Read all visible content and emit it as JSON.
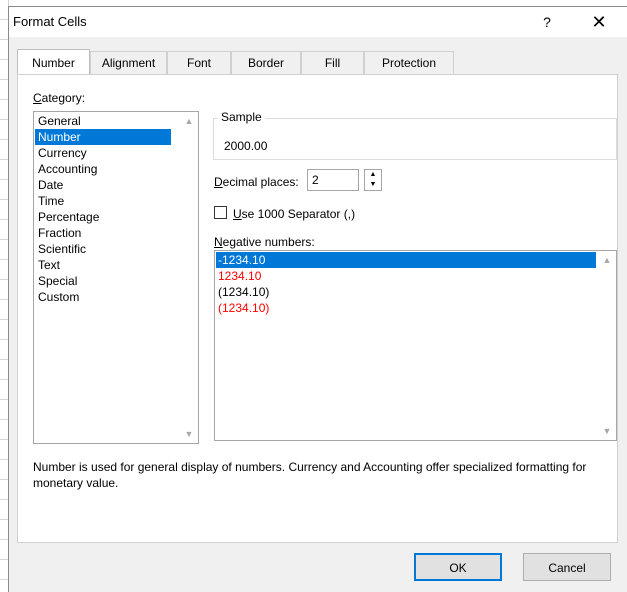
{
  "window": {
    "title": "Format Cells",
    "help_glyph": "?",
    "close_glyph": "✕"
  },
  "tabs": [
    {
      "label": "Number",
      "active": true
    },
    {
      "label": "Alignment"
    },
    {
      "label": "Font"
    },
    {
      "label": "Border"
    },
    {
      "label": "Fill"
    },
    {
      "label": "Protection"
    }
  ],
  "category": {
    "label_first": "C",
    "label_rest": "ategory:",
    "items": [
      "General",
      "Number",
      "Currency",
      "Accounting",
      "Date",
      "Time",
      "Percentage",
      "Fraction",
      "Scientific",
      "Text",
      "Special",
      "Custom"
    ],
    "selected": "Number"
  },
  "sample": {
    "legend": "Sample",
    "value": "2000.00"
  },
  "decimal": {
    "label_first": "D",
    "label_rest": "ecimal places:",
    "value": "2"
  },
  "separator": {
    "label_first": "U",
    "label_rest": "se 1000 Separator (,)",
    "checked": false
  },
  "negative": {
    "label_first": "N",
    "label_rest": "egative numbers:",
    "items": [
      {
        "text": "-1234.10",
        "color": "#000000",
        "selected": true
      },
      {
        "text": "1234.10",
        "color": "#ff0000"
      },
      {
        "text": "(1234.10)",
        "color": "#000000"
      },
      {
        "text": "(1234.10)",
        "color": "#ff0000"
      }
    ]
  },
  "description": "Number is used for general display of numbers.  Currency and Accounting offer specialized formatting for monetary value.",
  "buttons": {
    "ok": "OK",
    "cancel": "Cancel"
  },
  "colors": {
    "accent": "#0078d7",
    "negative_red": "#ff0000"
  }
}
